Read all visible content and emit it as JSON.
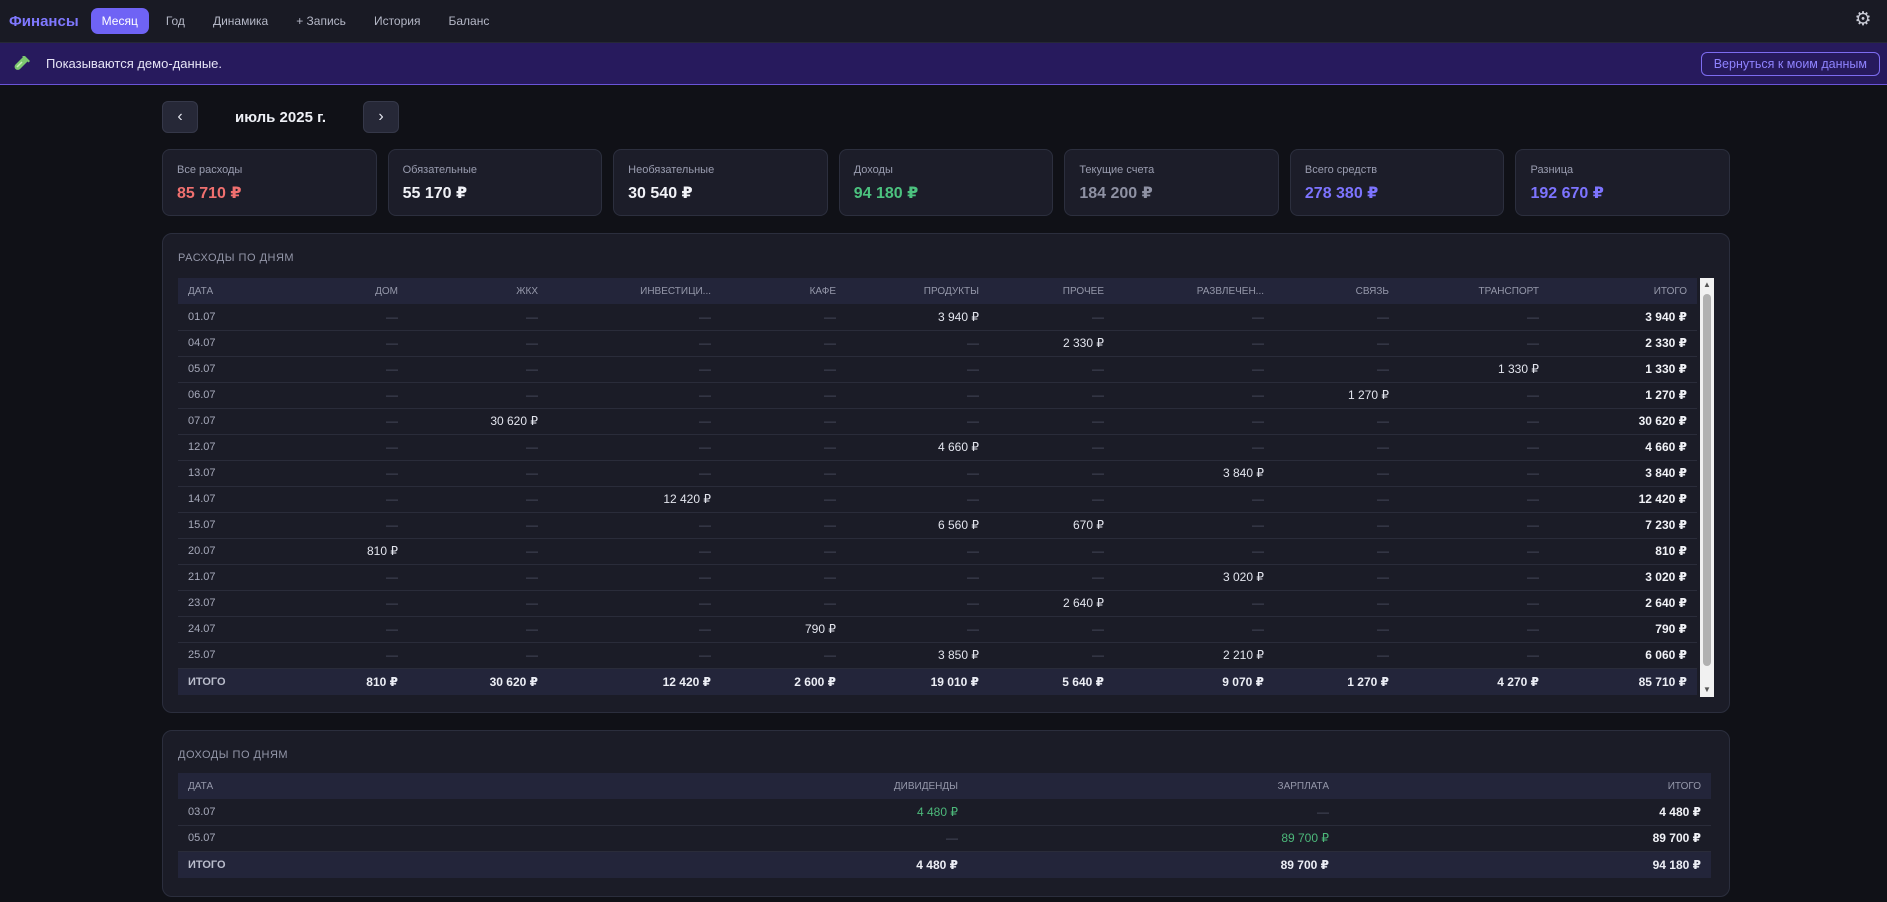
{
  "app": {
    "brand": "Финансы",
    "nav": [
      "Месяц",
      "Год",
      "Динамика",
      "+ Запись",
      "История",
      "Баланс"
    ],
    "active_nav": 0
  },
  "banner": {
    "text": "Показываются демо-данные.",
    "button": "Вернуться к моим данным"
  },
  "month": {
    "prev": "‹",
    "title": "июль 2025 г.",
    "next": "›"
  },
  "cards": [
    {
      "label": "Все расходы",
      "value": "85 710 ₽",
      "color": "#f0706f"
    },
    {
      "label": "Обязательные",
      "value": "55 170 ₽",
      "color": "#f1f2f7"
    },
    {
      "label": "Необязательные",
      "value": "30 540 ₽",
      "color": "#f1f2f7"
    },
    {
      "label": "Доходы",
      "value": "94 180 ₽",
      "color": "#4cc27f"
    },
    {
      "label": "Текущие счета",
      "value": "184 200 ₽",
      "color": "#8e91a3"
    },
    {
      "label": "Всего средств",
      "value": "278 380 ₽",
      "color": "#7d74ff"
    },
    {
      "label": "Разница",
      "value": "192 670 ₽",
      "color": "#7d74ff"
    }
  ],
  "expenses": {
    "title": "РАСХОДЫ ПО ДНЯМ",
    "columns": [
      "ДАТА",
      "ДОМ",
      "ЖКХ",
      "ИНВЕСТИЦИ...",
      "КАФЕ",
      "ПРОДУКТЫ",
      "ПРОЧЕЕ",
      "РАЗВЛЕЧЕН...",
      "СВЯЗЬ",
      "ТРАНСПОРТ",
      "ИТОГО"
    ],
    "rows": [
      [
        "01.07",
        "—",
        "—",
        "—",
        "—",
        "3 940 ₽",
        "—",
        "—",
        "—",
        "—",
        "3 940 ₽"
      ],
      [
        "04.07",
        "—",
        "—",
        "—",
        "—",
        "—",
        "2 330 ₽",
        "—",
        "—",
        "—",
        "2 330 ₽"
      ],
      [
        "05.07",
        "—",
        "—",
        "—",
        "—",
        "—",
        "—",
        "—",
        "—",
        "1 330 ₽",
        "1 330 ₽"
      ],
      [
        "06.07",
        "—",
        "—",
        "—",
        "—",
        "—",
        "—",
        "—",
        "1 270 ₽",
        "—",
        "1 270 ₽"
      ],
      [
        "07.07",
        "—",
        "30 620 ₽",
        "—",
        "—",
        "—",
        "—",
        "—",
        "—",
        "—",
        "30 620 ₽"
      ],
      [
        "12.07",
        "—",
        "—",
        "—",
        "—",
        "4 660 ₽",
        "—",
        "—",
        "—",
        "—",
        "4 660 ₽"
      ],
      [
        "13.07",
        "—",
        "—",
        "—",
        "—",
        "—",
        "—",
        "3 840 ₽",
        "—",
        "—",
        "3 840 ₽"
      ],
      [
        "14.07",
        "—",
        "—",
        "12 420 ₽",
        "—",
        "—",
        "—",
        "—",
        "—",
        "—",
        "12 420 ₽"
      ],
      [
        "15.07",
        "—",
        "—",
        "—",
        "—",
        "6 560 ₽",
        "670 ₽",
        "—",
        "—",
        "—",
        "7 230 ₽"
      ],
      [
        "20.07",
        "810 ₽",
        "—",
        "—",
        "—",
        "—",
        "—",
        "—",
        "—",
        "—",
        "810 ₽"
      ],
      [
        "21.07",
        "—",
        "—",
        "—",
        "—",
        "—",
        "—",
        "3 020 ₽",
        "—",
        "—",
        "3 020 ₽"
      ],
      [
        "23.07",
        "—",
        "—",
        "—",
        "—",
        "—",
        "2 640 ₽",
        "—",
        "—",
        "—",
        "2 640 ₽"
      ],
      [
        "24.07",
        "—",
        "—",
        "—",
        "790 ₽",
        "—",
        "—",
        "—",
        "—",
        "—",
        "790 ₽"
      ],
      [
        "25.07",
        "—",
        "—",
        "—",
        "—",
        "3 850 ₽",
        "—",
        "2 210 ₽",
        "—",
        "—",
        "6 060 ₽"
      ]
    ],
    "footer": [
      "ИТОГО",
      "810 ₽",
      "30 620 ₽",
      "12 420 ₽",
      "2 600 ₽",
      "19 010 ₽",
      "5 640 ₽",
      "9 070 ₽",
      "1 270 ₽",
      "4 270 ₽",
      "85 710 ₽"
    ]
  },
  "income": {
    "title": "ДОХОДЫ ПО ДНЯМ",
    "columns": [
      "ДАТА",
      "ДИВИДЕНДЫ",
      "ЗАРПЛАТА",
      "ИТОГО"
    ],
    "rows": [
      [
        "03.07",
        "4 480 ₽",
        "—",
        "4 480 ₽"
      ],
      [
        "05.07",
        "—",
        "89 700 ₽",
        "89 700 ₽"
      ]
    ],
    "footer": [
      "ИТОГО",
      "4 480 ₽",
      "89 700 ₽",
      "94 180 ₽"
    ]
  }
}
